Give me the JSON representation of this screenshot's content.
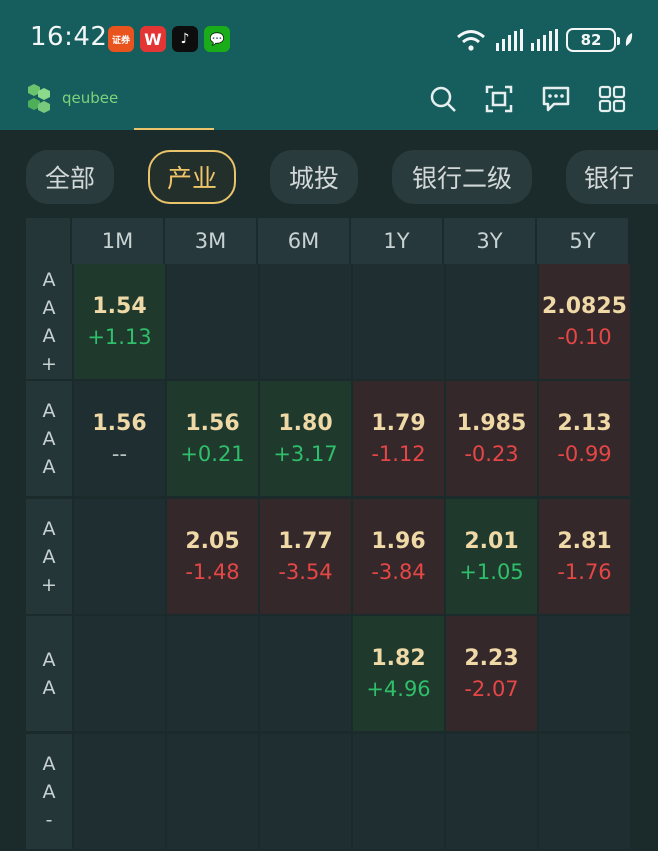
{
  "status_bar": {
    "time": "16:42",
    "battery": "82",
    "app_icons": [
      "securities-app-icon",
      "wps-icon",
      "tiktok-icon",
      "wechat-icon"
    ],
    "sec_icon_text": "证券",
    "wps_icon_text": "W",
    "tiktok_icon_text": "♪",
    "wechat_icon_text": "💬"
  },
  "header": {
    "logo_text": "qeubee",
    "icons": [
      "search-icon",
      "scan-icon",
      "message-icon",
      "apps-grid-icon"
    ]
  },
  "tabs": [
    {
      "label": "全部",
      "active": false
    },
    {
      "label": "产业",
      "active": true
    },
    {
      "label": "城投",
      "active": false
    },
    {
      "label": "银行二级",
      "active": false
    },
    {
      "label": "银行",
      "active": false
    }
  ],
  "table": {
    "columns": [
      "1M",
      "3M",
      "6M",
      "1Y",
      "3Y",
      "5Y"
    ],
    "rows": [
      {
        "label": [
          "A",
          "A",
          "A",
          "+"
        ],
        "cells": [
          {
            "value": "1.54",
            "change": "+1.13",
            "trend": "up"
          },
          null,
          null,
          null,
          null,
          {
            "value": "2.0825",
            "change": "-0.10",
            "trend": "down"
          }
        ]
      },
      {
        "label": [
          "A",
          "A",
          "A"
        ],
        "cells": [
          {
            "value": "1.56",
            "change": "--",
            "trend": "flat"
          },
          {
            "value": "1.56",
            "change": "+0.21",
            "trend": "up"
          },
          {
            "value": "1.80",
            "change": "+3.17",
            "trend": "up"
          },
          {
            "value": "1.79",
            "change": "-1.12",
            "trend": "down"
          },
          {
            "value": "1.985",
            "change": "-0.23",
            "trend": "down"
          },
          {
            "value": "2.13",
            "change": "-0.99",
            "trend": "down"
          }
        ]
      },
      {
        "label": [
          "A",
          "A",
          "+"
        ],
        "cells": [
          null,
          {
            "value": "2.05",
            "change": "-1.48",
            "trend": "down"
          },
          {
            "value": "1.77",
            "change": "-3.54",
            "trend": "down"
          },
          {
            "value": "1.96",
            "change": "-3.84",
            "trend": "down"
          },
          {
            "value": "2.01",
            "change": "+1.05",
            "trend": "up"
          },
          {
            "value": "2.81",
            "change": "-1.76",
            "trend": "down"
          }
        ]
      },
      {
        "label": [
          "A",
          "A"
        ],
        "cells": [
          null,
          null,
          null,
          {
            "value": "1.82",
            "change": "+4.96",
            "trend": "up"
          },
          {
            "value": "2.23",
            "change": "-2.07",
            "trend": "down"
          },
          null
        ]
      },
      {
        "label": [
          "A",
          "A",
          "-"
        ],
        "cells": [
          null,
          null,
          null,
          null,
          null,
          null
        ]
      }
    ]
  },
  "colors": {
    "header_bg": "#165e5d",
    "page_bg": "#1b2a2b",
    "active_tab": "#e9c46a",
    "positive": "#2fbf6a",
    "negative": "#e54646",
    "value": "#efd9a6"
  }
}
